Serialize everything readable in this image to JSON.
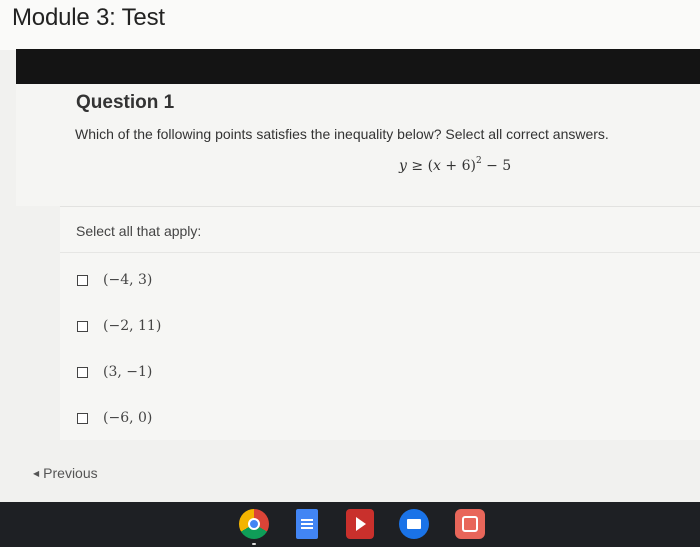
{
  "page": {
    "title": "Module 3: Test"
  },
  "question": {
    "title": "Question 1",
    "text": "Which of the following points satisfies the inequality below? Select all correct answers.",
    "equation": {
      "lhs": "y",
      "relation": "≥",
      "open": "(",
      "var": "x",
      "middle": " + 6)",
      "exponent": "2",
      "tail": " − 5"
    }
  },
  "answers": {
    "hint": "Select all that apply:",
    "options": [
      {
        "label": "(−4, 3)",
        "checked": false
      },
      {
        "label": "(−2, 11)",
        "checked": false
      },
      {
        "label": "(3, −1)",
        "checked": false
      },
      {
        "label": "(−6, 0)",
        "checked": false
      }
    ]
  },
  "navigation": {
    "previous_label": "Previous",
    "previous_icon": "chevron-left-icon"
  },
  "dock": {
    "apps": [
      {
        "name": "chrome-icon"
      },
      {
        "name": "docs-icon"
      },
      {
        "name": "play-store-icon"
      },
      {
        "name": "files-icon"
      },
      {
        "name": "photos-icon"
      }
    ]
  }
}
